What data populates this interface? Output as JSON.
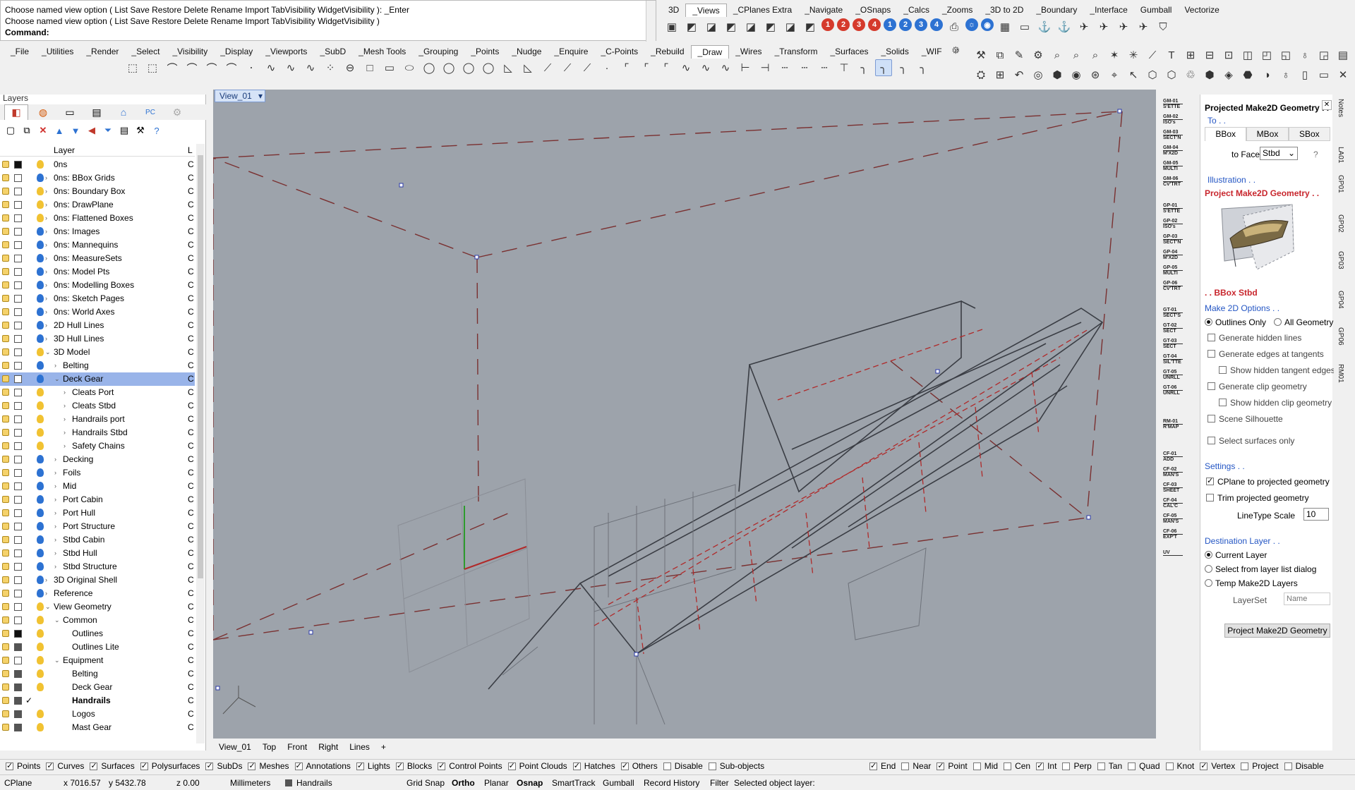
{
  "command": {
    "line1": "Choose named view option ( List  Save  Restore  Delete  Rename  Import  TabVisibility  WidgetVisibility ): _Enter",
    "line2": "Choose named view option ( List  Save  Restore  Delete  Rename  Import  TabVisibility  WidgetVisibility )",
    "prompt": "Command:"
  },
  "top_tabs": [
    "3D",
    "_Views",
    "_CPlanes Extra",
    "_Navigate",
    "_OSnaps",
    "_Calcs",
    "_Zooms",
    "_3D to 2D",
    "_Boundary",
    "_Interface",
    "Gumball",
    "Vectorize"
  ],
  "main_tabs": [
    "_File",
    "_Utilities",
    "_Render",
    "_Select",
    "_Visibility",
    "_Display",
    "_Viewports",
    "_SubD",
    "_Mesh Tools",
    "_Grouping",
    "_Points",
    "_Nudge",
    "_Enquire",
    "_C-Points",
    "_Rebuild",
    "_Draw",
    "_Wires",
    "_Transform",
    "_Surfaces",
    "_Solids",
    "_WIF"
  ],
  "layers": {
    "title": "Layers",
    "column_header": "Layer",
    "column_l": "L",
    "rows": [
      {
        "name": "0ns",
        "indent": 0,
        "arrow": "",
        "swatch": "blk",
        "bulb": "#f1c232",
        "c": "C"
      },
      {
        "name": "0ns: BBox Grids",
        "indent": 0,
        "arrow": "›",
        "swatch": "",
        "bulb": "#2d72d2",
        "c": "C"
      },
      {
        "name": "0ns: Boundary Box",
        "indent": 0,
        "arrow": "›",
        "swatch": "",
        "bulb": "#f1c232",
        "c": "C"
      },
      {
        "name": "0ns: DrawPlane",
        "indent": 0,
        "arrow": "›",
        "swatch": "",
        "bulb": "#f1c232",
        "c": "C"
      },
      {
        "name": "0ns: Flattened Boxes",
        "indent": 0,
        "arrow": "›",
        "swatch": "",
        "bulb": "#f1c232",
        "c": "C"
      },
      {
        "name": "0ns: Images",
        "indent": 0,
        "arrow": "›",
        "swatch": "",
        "bulb": "#2d72d2",
        "c": "C"
      },
      {
        "name": "0ns: Mannequins",
        "indent": 0,
        "arrow": "›",
        "swatch": "",
        "bulb": "#2d72d2",
        "c": "C"
      },
      {
        "name": "0ns: MeasureSets",
        "indent": 0,
        "arrow": "›",
        "swatch": "",
        "bulb": "#2d72d2",
        "c": "C"
      },
      {
        "name": "0ns: Model Pts",
        "indent": 0,
        "arrow": "›",
        "swatch": "",
        "bulb": "#2d72d2",
        "c": "C"
      },
      {
        "name": "0ns: Modelling Boxes",
        "indent": 0,
        "arrow": "›",
        "swatch": "",
        "bulb": "#2d72d2",
        "c": "C"
      },
      {
        "name": "0ns: Sketch Pages",
        "indent": 0,
        "arrow": "›",
        "swatch": "",
        "bulb": "#2d72d2",
        "c": "C"
      },
      {
        "name": "0ns: World Axes",
        "indent": 0,
        "arrow": "›",
        "swatch": "",
        "bulb": "#2d72d2",
        "c": "C"
      },
      {
        "name": "2D Hull Lines",
        "indent": 0,
        "arrow": "›",
        "swatch": "",
        "bulb": "#2d72d2",
        "c": "C"
      },
      {
        "name": "3D Hull Lines",
        "indent": 0,
        "arrow": "›",
        "swatch": "",
        "bulb": "#2d72d2",
        "c": "C"
      },
      {
        "name": "3D Model",
        "indent": 0,
        "arrow": "⌄",
        "swatch": "",
        "bulb": "#f1c232",
        "c": "C"
      },
      {
        "name": "Belting",
        "indent": 1,
        "arrow": "›",
        "swatch": "",
        "bulb": "#2d72d2",
        "c": "C"
      },
      {
        "name": "Deck Gear",
        "indent": 1,
        "arrow": "⌄",
        "swatch": "",
        "bulb": "#2d72d2",
        "c": "C",
        "selected": true
      },
      {
        "name": "Cleats Port",
        "indent": 2,
        "arrow": "›",
        "swatch": "",
        "bulb": "#f1c232",
        "c": "C"
      },
      {
        "name": "Cleats Stbd",
        "indent": 2,
        "arrow": "›",
        "swatch": "",
        "bulb": "#f1c232",
        "c": "C"
      },
      {
        "name": "Handrails port",
        "indent": 2,
        "arrow": "›",
        "swatch": "",
        "bulb": "#f1c232",
        "c": "C"
      },
      {
        "name": "Handrails Stbd",
        "indent": 2,
        "arrow": "›",
        "swatch": "",
        "bulb": "#f1c232",
        "c": "C"
      },
      {
        "name": "Safety Chains",
        "indent": 2,
        "arrow": "›",
        "swatch": "",
        "bulb": "#f1c232",
        "c": "C"
      },
      {
        "name": "Decking",
        "indent": 1,
        "arrow": "›",
        "swatch": "",
        "bulb": "#2d72d2",
        "c": "C"
      },
      {
        "name": "Foils",
        "indent": 1,
        "arrow": "›",
        "swatch": "",
        "bulb": "#2d72d2",
        "c": "C"
      },
      {
        "name": "Mid",
        "indent": 1,
        "arrow": "›",
        "swatch": "",
        "bulb": "#2d72d2",
        "c": "C"
      },
      {
        "name": "Port Cabin",
        "indent": 1,
        "arrow": "›",
        "swatch": "",
        "bulb": "#2d72d2",
        "c": "C"
      },
      {
        "name": "Port Hull",
        "indent": 1,
        "arrow": "›",
        "swatch": "",
        "bulb": "#2d72d2",
        "c": "C"
      },
      {
        "name": "Port Structure",
        "indent": 1,
        "arrow": "›",
        "swatch": "",
        "bulb": "#2d72d2",
        "c": "C"
      },
      {
        "name": "Stbd Cabin",
        "indent": 1,
        "arrow": "›",
        "swatch": "",
        "bulb": "#2d72d2",
        "c": "C"
      },
      {
        "name": "Stbd Hull",
        "indent": 1,
        "arrow": "›",
        "swatch": "",
        "bulb": "#2d72d2",
        "c": "C"
      },
      {
        "name": "Stbd Structure",
        "indent": 1,
        "arrow": "›",
        "swatch": "",
        "bulb": "#2d72d2",
        "c": "C"
      },
      {
        "name": "3D Original Shell",
        "indent": 0,
        "arrow": "›",
        "swatch": "",
        "bulb": "#2d72d2",
        "c": "C"
      },
      {
        "name": "Reference",
        "indent": 0,
        "arrow": "›",
        "swatch": "",
        "bulb": "#2d72d2",
        "c": "C"
      },
      {
        "name": "View Geometry",
        "indent": 0,
        "arrow": "⌄",
        "swatch": "",
        "bulb": "#f1c232",
        "c": "C"
      },
      {
        "name": "Common",
        "indent": 1,
        "arrow": "⌄",
        "swatch": "",
        "bulb": "#f1c232",
        "c": "C"
      },
      {
        "name": "Outlines",
        "indent": 2,
        "arrow": "",
        "swatch": "blk",
        "bulb": "#f1c232",
        "c": "C"
      },
      {
        "name": "Outlines Lite",
        "indent": 2,
        "arrow": "",
        "swatch": "gry",
        "bulb": "#f1c232",
        "c": "C"
      },
      {
        "name": "Equipment",
        "indent": 1,
        "arrow": "⌄",
        "swatch": "",
        "bulb": "#f1c232",
        "c": "C"
      },
      {
        "name": "Belting",
        "indent": 2,
        "arrow": "",
        "swatch": "gry",
        "bulb": "#f1c232",
        "c": "C"
      },
      {
        "name": "Deck Gear",
        "indent": 2,
        "arrow": "",
        "swatch": "gry",
        "bulb": "#f1c232",
        "c": "C"
      },
      {
        "name": "Handrails",
        "indent": 2,
        "arrow": "",
        "swatch": "gry",
        "bulb": "",
        "c": "C",
        "bold": true,
        "check": "✓"
      },
      {
        "name": "Logos",
        "indent": 2,
        "arrow": "",
        "swatch": "gry",
        "bulb": "#f1c232",
        "c": "C"
      },
      {
        "name": "Mast Gear",
        "indent": 2,
        "arrow": "",
        "swatch": "gry",
        "bulb": "#f1c232",
        "c": "C"
      }
    ]
  },
  "viewport": {
    "name": "View_01",
    "tabs": [
      "View_01",
      "Top",
      "Front",
      "Right",
      "Lines",
      "+"
    ]
  },
  "cmd_column": [
    {
      "a": "GM-01",
      "b": "S'ETTE"
    },
    {
      "a": "GM-02",
      "b": "ISO's"
    },
    {
      "a": "GM-03",
      "b": "SECT'N"
    },
    {
      "a": "GM-04",
      "b": "M'X2D"
    },
    {
      "a": "GM-05",
      "b": "MULTI"
    },
    {
      "a": "GM-06",
      "b": "CV'TRT"
    },
    {
      "a": "GP-01",
      "b": "S'ETTE"
    },
    {
      "a": "GP-02",
      "b": "ISO's"
    },
    {
      "a": "GP-03",
      "b": "SECT'N"
    },
    {
      "a": "GP-04",
      "b": "M'X2D"
    },
    {
      "a": "GP-05",
      "b": "MULTI"
    },
    {
      "a": "GP-06",
      "b": "CV'TRT"
    },
    {
      "a": "GT-01",
      "b": "SECT'S"
    },
    {
      "a": "GT-02",
      "b": "SECT"
    },
    {
      "a": "GT-03",
      "b": "SECT"
    },
    {
      "a": "GT-04",
      "b": "SIL'TTE"
    },
    {
      "a": "GT-05",
      "b": "UNRLL"
    },
    {
      "a": "GT-06",
      "b": "UNRLL"
    },
    {
      "a": "RM-01",
      "b": "R'MAP"
    },
    {
      "a": "CF-01",
      "b": "ADD"
    },
    {
      "a": "CF-02",
      "b": "MAN'S"
    },
    {
      "a": "CF-03",
      "b": "SHEET"
    },
    {
      "a": "CF-04",
      "b": "CAL'C"
    },
    {
      "a": "CF-05",
      "b": "MAN'S"
    },
    {
      "a": "CF-06",
      "b": "EXP'T"
    },
    {
      "a": "UV",
      "b": ""
    }
  ],
  "panel": {
    "title": "Projected Make2D Geometry . .",
    "to": "To . .",
    "tabs": [
      "BBox",
      "MBox",
      "SBox"
    ],
    "to_face_label": "to Face",
    "to_face_value": "Stbd",
    "help": "?",
    "illustration": "Illustration . .",
    "illus_title": "Project Make2D Geometry . .",
    "illus_caption": ". . BBox Stbd",
    "make2d_options": "Make 2D Options . .",
    "outlines_only": "Outlines Only",
    "all_geometry": "All Geometry",
    "gen_hidden": "Generate hidden lines",
    "gen_tangent": "Generate edges at tangents",
    "show_hidden_tangent": "Show hidden tangent edges",
    "gen_clip": "Generate clip geometry",
    "show_hidden_clip": "Show hidden clip geometry",
    "scene_silhouette": "Scene Silhouette",
    "select_surfaces": "Select surfaces only",
    "settings": "Settings . .",
    "cplane_projected": "CPlane to projected geometry",
    "trim_projected": "Trim projected geometry",
    "linetype_label": "LineType Scale",
    "linetype_value": "10",
    "destination": "Destination Layer . .",
    "current_layer": "Current Layer",
    "select_from_list": "Select from layer list dialog",
    "temp_layers": "Temp Make2D Layers",
    "layerset_label": "LayerSet",
    "layerset_placeholder": "Name",
    "project_button": "Project Make2D Geometry"
  },
  "vtabs": [
    "Notes",
    "LA01",
    "GP01",
    "GP02",
    "GP03",
    "GP04",
    "GP06",
    "RM01"
  ],
  "filter_bar": {
    "left": [
      {
        "label": "Points",
        "on": true
      },
      {
        "label": "Curves",
        "on": true
      },
      {
        "label": "Surfaces",
        "on": true
      },
      {
        "label": "Polysurfaces",
        "on": true
      },
      {
        "label": "SubDs",
        "on": true
      },
      {
        "label": "Meshes",
        "on": true
      },
      {
        "label": "Annotations",
        "on": true
      },
      {
        "label": "Lights",
        "on": true
      },
      {
        "label": "Blocks",
        "on": true
      },
      {
        "label": "Control Points",
        "on": true
      },
      {
        "label": "Point Clouds",
        "on": true
      },
      {
        "label": "Hatches",
        "on": true
      },
      {
        "label": "Others",
        "on": true
      },
      {
        "label": "Disable",
        "on": false
      },
      {
        "label": "Sub-objects",
        "on": false
      }
    ],
    "right": [
      {
        "label": "End",
        "on": true
      },
      {
        "label": "Near",
        "on": false
      },
      {
        "label": "Point",
        "on": true
      },
      {
        "label": "Mid",
        "on": false
      },
      {
        "label": "Cen",
        "on": false
      },
      {
        "label": "Int",
        "on": true
      },
      {
        "label": "Perp",
        "on": false
      },
      {
        "label": "Tan",
        "on": false
      },
      {
        "label": "Quad",
        "on": false
      },
      {
        "label": "Knot",
        "on": false
      },
      {
        "label": "Vertex",
        "on": true
      },
      {
        "label": "Project",
        "on": false
      },
      {
        "label": "Disable",
        "on": false
      }
    ]
  },
  "status": {
    "cplane": "CPlane",
    "x": "x 7016.57",
    "y": "y 5432.78",
    "z": "z 0.00",
    "units": "Millimeters",
    "layer": "Handrails",
    "grid_snap": "Grid Snap",
    "ortho": "Ortho",
    "planar": "Planar",
    "osnap": "Osnap",
    "smarttrack": "SmartTrack",
    "gumball": "Gumball",
    "record_history": "Record History",
    "filter": "Filter",
    "selected": "Selected object layer:"
  }
}
